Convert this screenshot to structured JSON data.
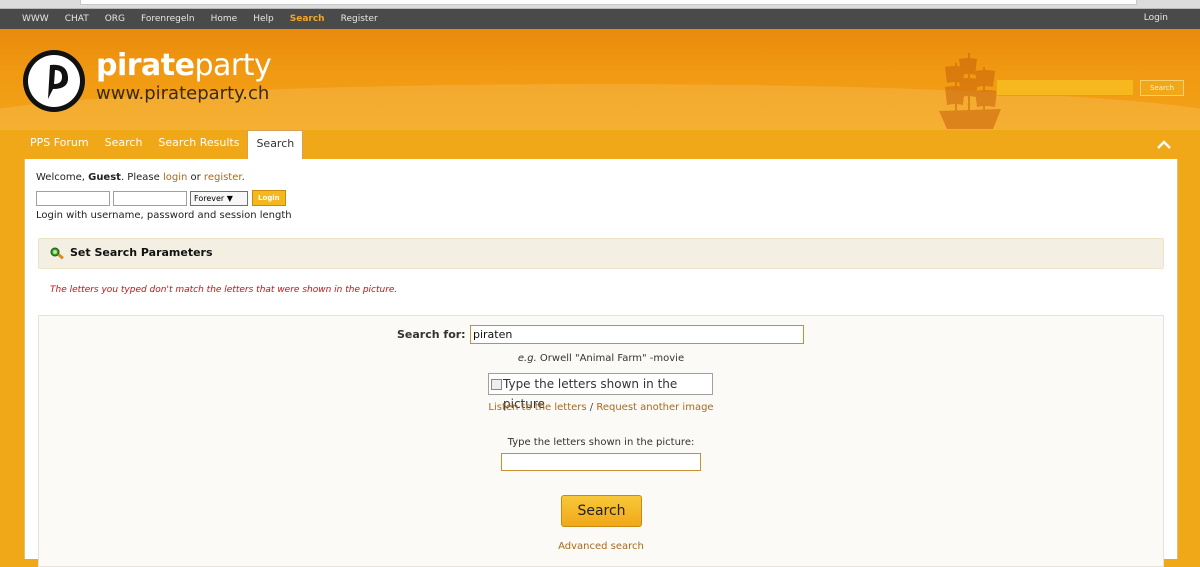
{
  "topnav": {
    "items": [
      "WWW",
      "CHAT",
      "ORG",
      "Forenregeln",
      "Home",
      "Help",
      "Search",
      "Register"
    ],
    "active": "Search",
    "login": "Login"
  },
  "header": {
    "logo_word_bold": "pirate",
    "logo_word_thin": "party",
    "logo_url": "www.pirateparty.ch",
    "search_button": "Search"
  },
  "tabs": [
    "PPS Forum",
    "Search",
    "Search Results",
    "Search"
  ],
  "welcome": {
    "prefix": "Welcome, ",
    "user": "Guest",
    "middle": ". Please ",
    "login_link": "login",
    "or": " or ",
    "register_link": "register",
    "suffix": ".",
    "session_option": "Forever ▼",
    "login_button": "Login",
    "help": "Login with username, password and session length"
  },
  "section": {
    "title": "Set Search Parameters"
  },
  "error_message": "The letters you typed don't match the letters that were shown in the picture.",
  "search": {
    "label": "Search for:",
    "value": "piraten",
    "example_prefix": "e.g.",
    "example_text": " Orwell \"Animal Farm\" -movie",
    "captcha_alt": "Type the letters shown in the picture",
    "listen_link": "Listen to the letters",
    "separator": " / ",
    "request_link": "Request another image",
    "type_label": "Type the letters shown in the picture:",
    "submit": "Search",
    "advanced": "Advanced search"
  },
  "colors": {
    "brand_orange": "#f0a818",
    "topnav_bg": "#4a4a4a",
    "link": "#a86a1a",
    "error": "#d01010"
  }
}
